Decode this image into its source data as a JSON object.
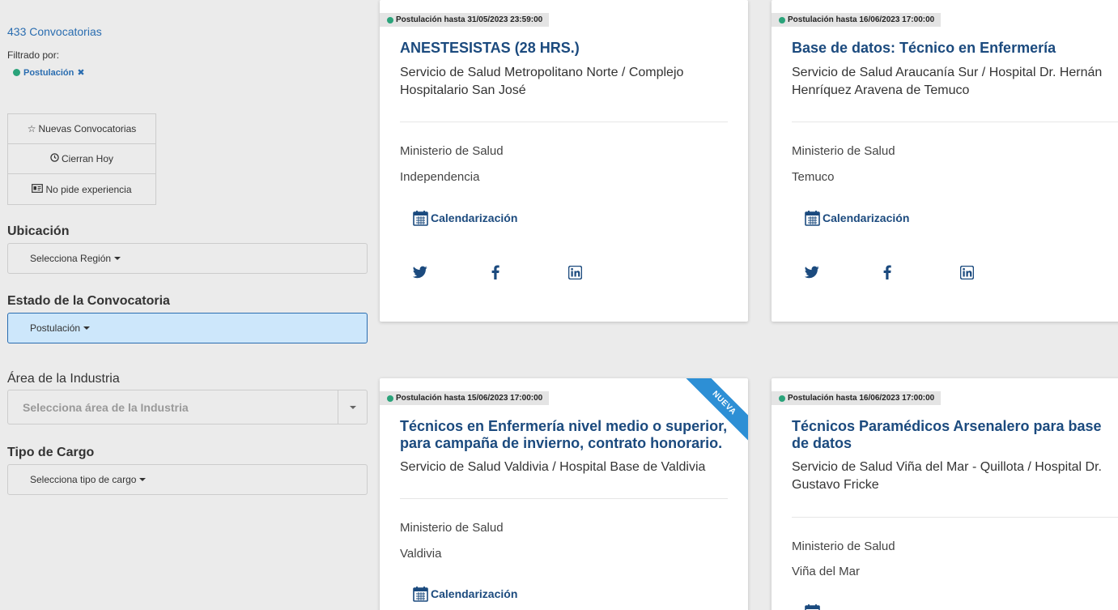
{
  "sidebar": {
    "count_link": "433 Convocatorias",
    "filtered_label": "Filtrado por:",
    "active_filter": "Postulación",
    "quick_filters": [
      {
        "label": "Nuevas Convocatorias",
        "icon": "star-outline-icon"
      },
      {
        "label": "Cierran Hoy",
        "icon": "clock-icon"
      },
      {
        "label": "No pide experiencia",
        "icon": "id-card-icon"
      }
    ],
    "ubicacion": {
      "title": "Ubicación",
      "button": "Selecciona Región"
    },
    "estado": {
      "title": "Estado de la Convocatoria",
      "button": "Postulación"
    },
    "area": {
      "title": "Área de la Industria",
      "placeholder": "Selecciona área de la Industria"
    },
    "tipo": {
      "title": "Tipo de Cargo",
      "button": "Selecciona tipo de cargo"
    }
  },
  "cards": [
    {
      "badge": "Postulación hasta 31/05/2023 23:59:00",
      "title": "ANESTESISTAS (28 HRS.)",
      "subtitle": "Servicio de Salud Metropolitano Norte / Complejo Hospitalario San José",
      "ministry": "Ministerio de Salud",
      "city": "Independencia",
      "calendar": "Calendarización"
    },
    {
      "badge": "Postulación hasta 16/06/2023 17:00:00",
      "title": "Base de datos: Técnico en Enfermería",
      "subtitle": "Servicio de Salud Araucanía Sur / Hospital Dr. Hernán Henríquez Aravena de Temuco",
      "ministry": "Ministerio de Salud",
      "city": "Temuco",
      "calendar": "Calendarización"
    },
    {
      "badge": "Postulación hasta 15/06/2023 17:00:00",
      "title": "Técnicos en Enfermería nivel medio o superior, para campaña de invierno, contrato honorario.",
      "subtitle": "Servicio de Salud Valdivia / Hospital Base de Valdivia",
      "ministry": "Ministerio de Salud",
      "city": "Valdivia",
      "calendar": "Calendarización",
      "ribbon": "NUEVA"
    },
    {
      "badge": "Postulación hasta 16/06/2023 17:00:00",
      "title": "Técnicos Paramédicos Arsenalero para base de datos",
      "subtitle": "Servicio de Salud Viña del Mar - Quillota / Hospital Dr. Gustavo Fricke",
      "ministry": "Ministerio de Salud",
      "city": "Viña del Mar"
    }
  ],
  "colors": {
    "accent": "#1b4a7e",
    "link": "#2a6db0",
    "status_dot": "#2aa37a",
    "ribbon": "#2d8fd5",
    "active_dropdown": "#cde7fb"
  }
}
